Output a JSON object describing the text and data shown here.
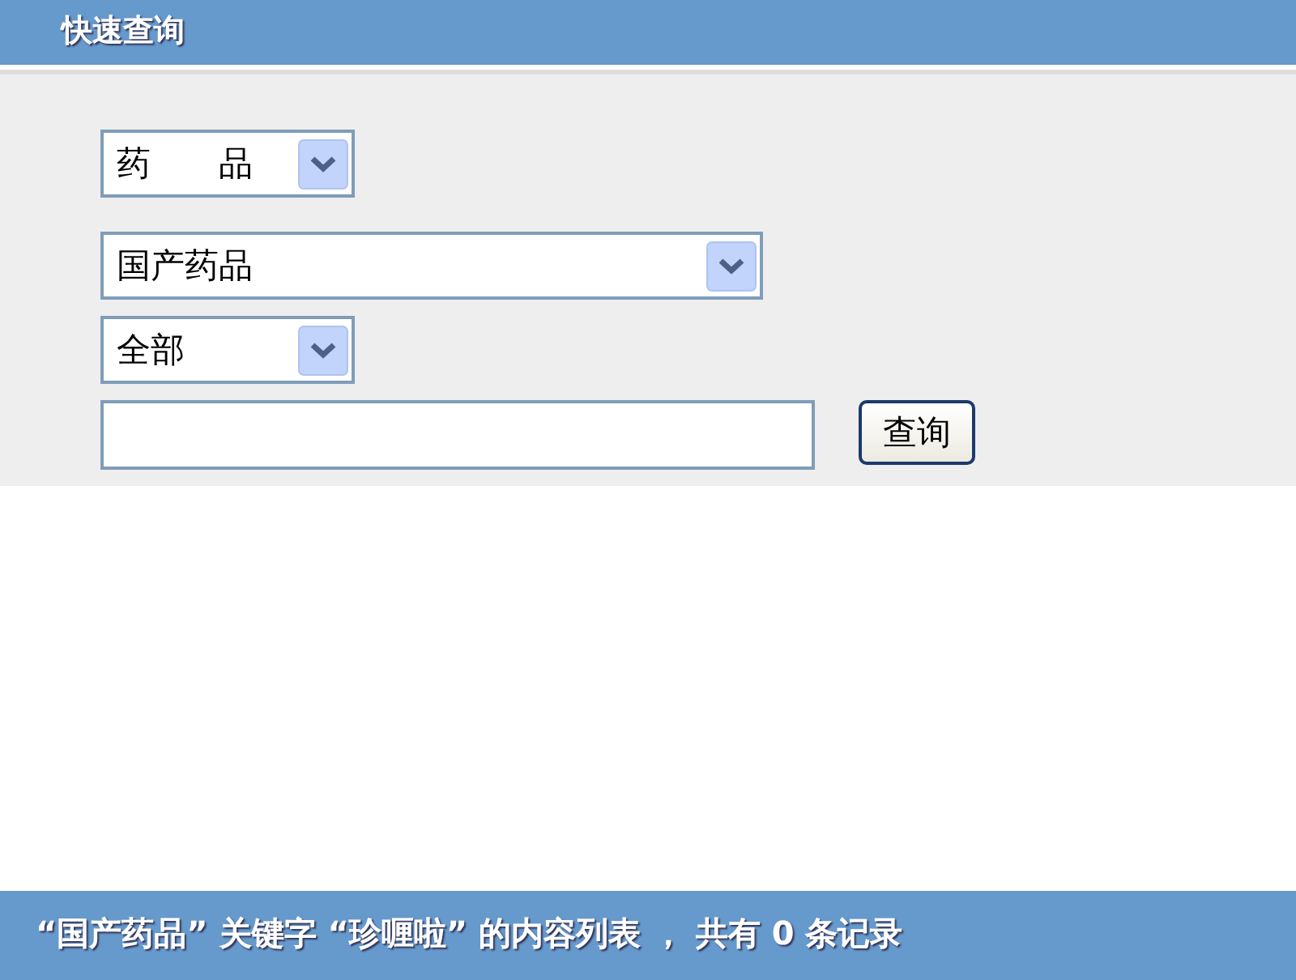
{
  "header": {
    "title": "快速查询"
  },
  "filters": [
    {
      "value": "药　　品"
    },
    {
      "value": "国产药品"
    },
    {
      "value": "全部"
    }
  ],
  "search": {
    "button": "查询"
  },
  "status_bar": {
    "text": "“国产药品” 关键字 “珍喱啦” 的内容列表 ， 共有 0 条记录"
  }
}
